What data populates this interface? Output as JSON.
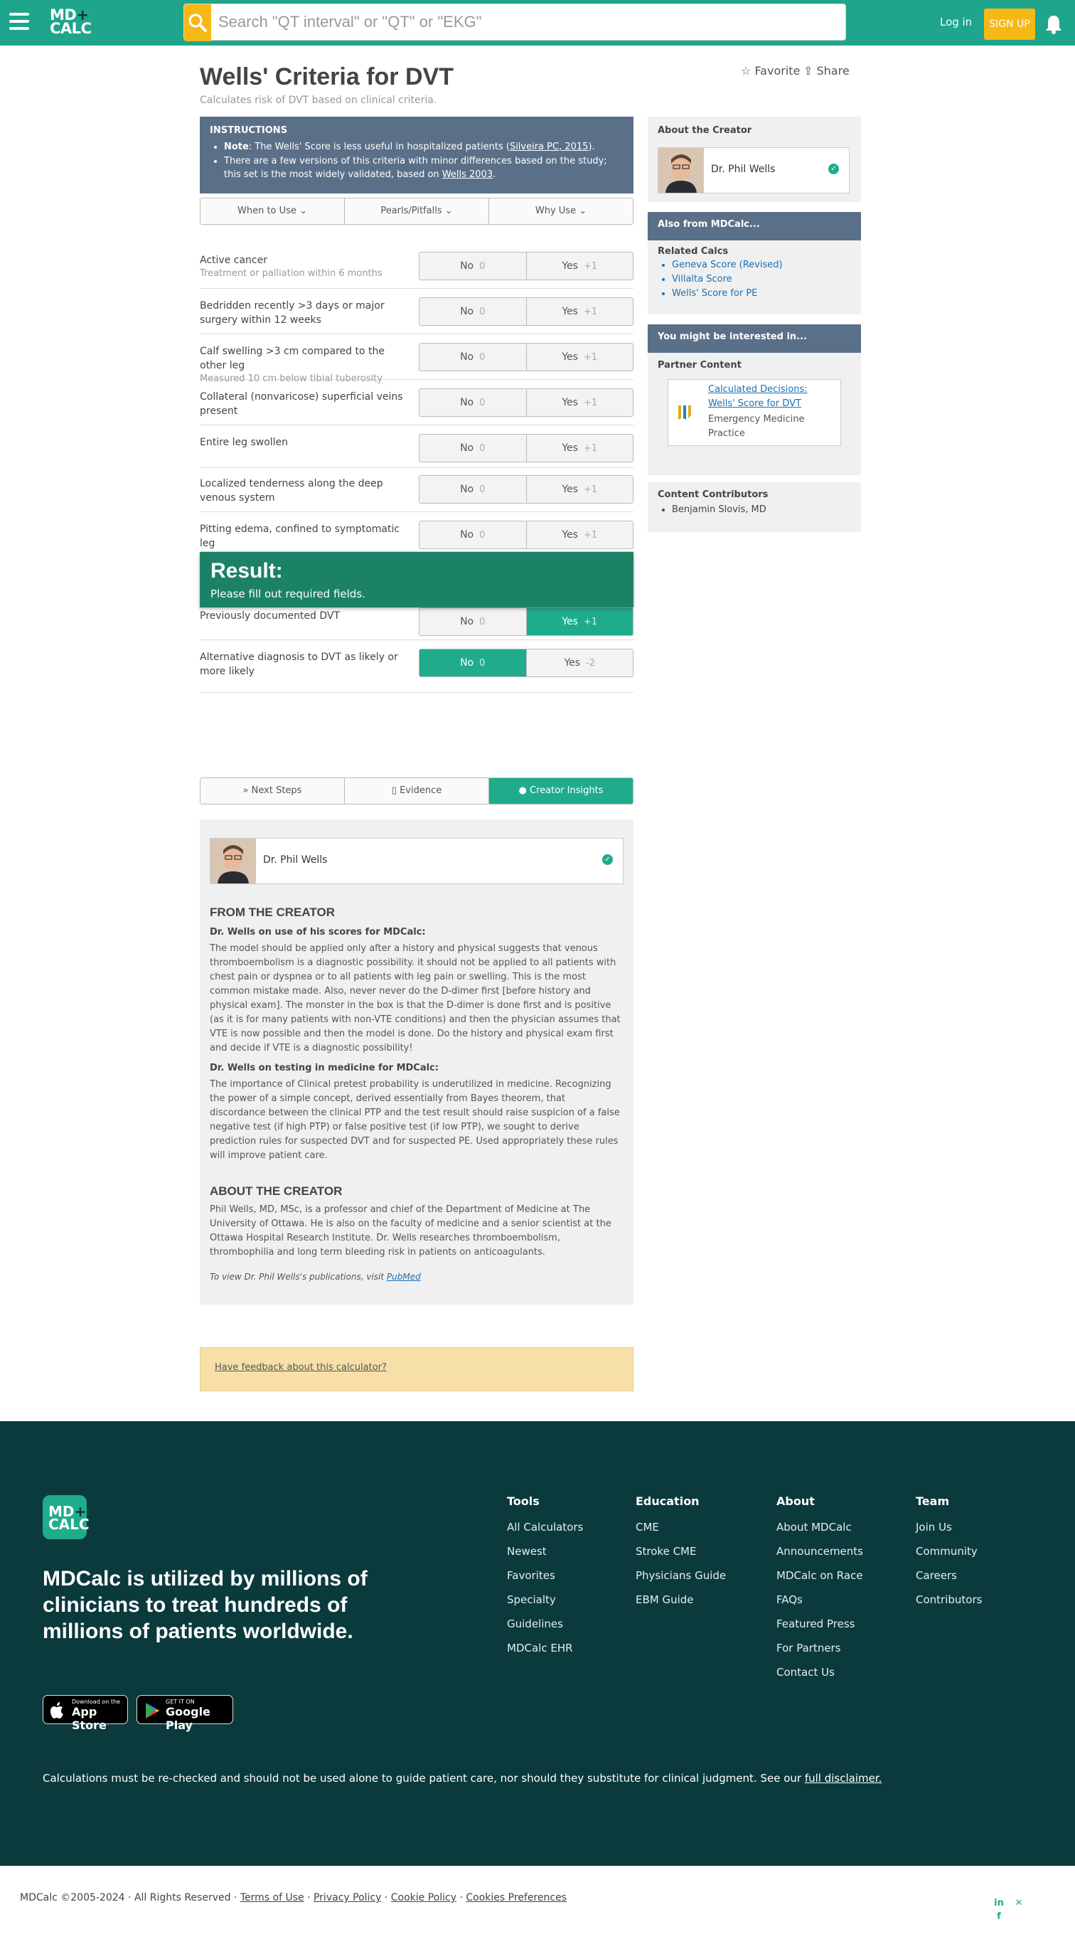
{
  "header": {
    "logo_line1": "MD",
    "logo_plus": "+",
    "logo_line2": "CALC",
    "search_placeholder": "Search \"QT interval\" or \"QT\" or \"EKG\"",
    "login": "Log in",
    "signup": "SIGN UP",
    "icons": [
      "menu-icon",
      "search-icon",
      "bell-icon"
    ]
  },
  "calc": {
    "title": "Wells' Criteria for DVT",
    "subtitle": "Calculates risk of DVT based on clinical criteria.",
    "favorite": "Favorite",
    "share": "Share"
  },
  "instructions": {
    "heading": "INSTRUCTIONS",
    "note_label": "Note",
    "note_text": ": The Wells' Score is less useful in hospitalized patients (",
    "note_link": "Silveira PC, 2015",
    "note_end": ").",
    "item2_text": "There are a few versions of this criteria with minor differences based on the study; this set is the most widely validated, based on ",
    "item2_link": "Wells 2003",
    "item2_end": "."
  },
  "info_tabs": [
    "When to Use",
    "Pearls/Pitfalls",
    "Why Use"
  ],
  "criteria": [
    {
      "label": "Active cancer",
      "sub": "Treatment or palliation within 6 months",
      "no": "No",
      "no_pts": "0",
      "yes": "Yes",
      "yes_pts": "+1",
      "selected": "none"
    },
    {
      "label": "Bedridden recently >3 days or major surgery within 12 weeks",
      "sub": "",
      "no": "No",
      "no_pts": "0",
      "yes": "Yes",
      "yes_pts": "+1",
      "selected": "none"
    },
    {
      "label": "Calf swelling >3 cm compared to the other leg",
      "sub": "Measured 10 cm below tibial tuberosity",
      "no": "No",
      "no_pts": "0",
      "yes": "Yes",
      "yes_pts": "+1",
      "selected": "none"
    },
    {
      "label": "Collateral (nonvaricose) superficial veins present",
      "sub": "",
      "no": "No",
      "no_pts": "0",
      "yes": "Yes",
      "yes_pts": "+1",
      "selected": "none"
    },
    {
      "label": "Entire leg swollen",
      "sub": "",
      "no": "No",
      "no_pts": "0",
      "yes": "Yes",
      "yes_pts": "+1",
      "selected": "none"
    },
    {
      "label": "Localized tenderness along the deep venous system",
      "sub": "",
      "no": "No",
      "no_pts": "0",
      "yes": "Yes",
      "yes_pts": "+1",
      "selected": "none"
    },
    {
      "label": "Pitting edema, confined to symptomatic leg",
      "sub": "",
      "no": "No",
      "no_pts": "0",
      "yes": "Yes",
      "yes_pts": "+1",
      "selected": "none"
    },
    {
      "label": "Previously documented DVT",
      "sub": "",
      "no": "No",
      "no_pts": "0",
      "yes": "Yes",
      "yes_pts": "+1",
      "selected": "yes"
    },
    {
      "label": "Alternative diagnosis to DVT as likely or more likely",
      "sub": "",
      "no": "No",
      "no_pts": "0",
      "yes": "Yes",
      "yes_pts": "-2",
      "selected": "no"
    }
  ],
  "result": {
    "heading": "Result:",
    "message": "Please fill out required fields."
  },
  "section_tabs": [
    "Next Steps",
    "Evidence",
    "Creator Insights"
  ],
  "insights": {
    "creator_name": "Dr. Phil Wells",
    "from_heading": "FROM THE CREATOR",
    "q1": "Dr. Wells on use of his scores for MDCalc:",
    "a1": "The model should be applied only after a history and physical suggests that venous thromboembolism is a diagnostic possibility. it should not be applied to all patients with chest pain or dyspnea or to all patients with leg pain or swelling. This is the most common mistake made. Also, never never do the D-dimer first [before history and physical exam]. The monster in the box is that the D-dimer is done first and is positive (as it is for many patients with non-VTE conditions) and then the physician assumes that VTE is now possible and then the model is done. Do the history and physical exam first and decide if VTE is a diagnostic possibility!",
    "q2": "Dr. Wells on testing in medicine for MDCalc:",
    "a2": "The importance of Clinical pretest probability is underutilized in medicine. Recognizing the power of a simple concept, derived essentially from Bayes theorem, that discordance between the clinical PTP and the test result should raise suspicion of a false negative test (if high PTP) or false positive test (if low PTP), we sought to derive prediction rules for suspected DVT and for suspected PE. Used appropriately these rules will improve patient care.",
    "about_heading": "ABOUT THE CREATOR",
    "about_text": "Phil Wells, MD, MSc, is a professor and chief of the Department of Medicine at The University of Ottawa. He is also on the faculty of medicine and a senior scientist at the Ottawa Hospital Research Institute. Dr. Wells researches thromboembolism, thrombophilia and long term bleeding risk in patients on anticoagulants.",
    "pub_text": "To view Dr. Phil Wells's publications, visit ",
    "pub_link": "PubMed"
  },
  "feedback": "Have feedback about this calculator?",
  "sidebar": {
    "about_title": "About the Creator",
    "creator_name": "Dr. Phil Wells",
    "also_from": "Also from MDCalc...",
    "related_title": "Related Calcs",
    "related": [
      "Geneva Score (Revised)",
      "Villalta Score",
      "Wells' Score for PE"
    ],
    "interested": "You might be interested in...",
    "partner_title": "Partner Content",
    "partner_link": "Calculated Decisions: Wells' Score for DVT",
    "partner_source": "Emergency Medicine Practice",
    "contrib_title": "Content Contributors",
    "contributors": [
      "Benjamin Slovis, MD"
    ]
  },
  "footer": {
    "mark_line1": "MD",
    "mark_plus": "+",
    "mark_line2": "CALC",
    "tagline": "MDCalc is utilized by millions of clinicians to treat hundreds of millions of patients worldwide.",
    "appstore_small": "Download on the",
    "appstore_big": "App Store",
    "googleplay_small": "GET IT ON",
    "googleplay_big": "Google Play",
    "columns": [
      {
        "title": "Tools",
        "links": [
          "All Calculators",
          "Newest",
          "Favorites",
          "Specialty",
          "Guidelines",
          "MDCalc EHR"
        ]
      },
      {
        "title": "Education",
        "links": [
          "CME",
          "Stroke CME",
          "Physicians Guide",
          "EBM Guide"
        ]
      },
      {
        "title": "About",
        "links": [
          "About MDCalc",
          "Announcements",
          "MDCalc on Race",
          "FAQs",
          "Featured Press",
          "For Partners",
          "Contact Us"
        ]
      },
      {
        "title": "Team",
        "links": [
          "Join Us",
          "Community",
          "Careers",
          "Contributors"
        ]
      }
    ],
    "disclaimer": "Calculations must be re-checked and should not be used alone to guide patient care, nor should they substitute for clinical judgment. See our ",
    "disclaimer_link": "full disclaimer."
  },
  "bottom": {
    "copyright": "MDCalc ©2005-2024 · All Rights Reserved · ",
    "links": [
      "Terms of Use",
      "Privacy Policy",
      "Cookie Policy",
      "Cookies Preferences"
    ],
    "social": [
      "linkedin-icon",
      "x-icon",
      "facebook-icon"
    ]
  },
  "colors": {
    "brand": "#1ea58c",
    "selected": "#1fac8c",
    "result": "#1c8266",
    "instructions": "#5a7089",
    "footer": "#0b3a3d",
    "signup": "#f6b816"
  }
}
